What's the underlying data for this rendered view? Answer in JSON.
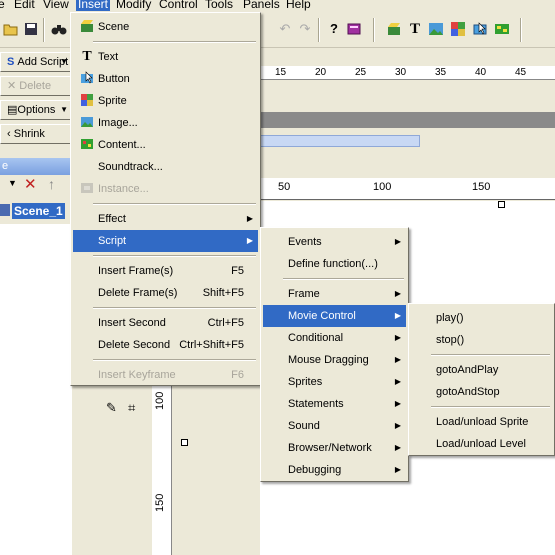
{
  "menubar": [
    "e",
    "Edit",
    "View",
    "Insert",
    "Modify",
    "Control",
    "Tools",
    "Panels",
    "Help"
  ],
  "left_panel": {
    "add_script": "Add Script",
    "delete": "Delete",
    "options": "Options",
    "shrink": "Shrink",
    "scene_header": "e",
    "scene_name": "Scene_1"
  },
  "ruler_top": [
    "15",
    "20",
    "25",
    "30",
    "35",
    "40",
    "45"
  ],
  "ruler_scene": [
    "50",
    "100",
    "150"
  ],
  "ruler_vertical": [
    "100",
    "150"
  ],
  "insert_menu": {
    "scene": "Scene",
    "text": "Text",
    "button": "Button",
    "sprite": "Sprite",
    "image": "Image...",
    "content": "Content...",
    "soundtrack": "Soundtrack...",
    "instance": "Instance...",
    "effect": "Effect",
    "script": "Script",
    "insert_frames": "Insert Frame(s)",
    "insert_frames_sc": "F5",
    "delete_frames": "Delete Frame(s)",
    "delete_frames_sc": "Shift+F5",
    "insert_second": "Insert Second",
    "insert_second_sc": "Ctrl+F5",
    "delete_second": "Delete Second",
    "delete_second_sc": "Ctrl+Shift+F5",
    "insert_keyframe": "Insert Keyframe",
    "insert_keyframe_sc": "F6"
  },
  "script_menu": {
    "events": "Events",
    "define_function": "Define function(...)",
    "frame": "Frame",
    "movie_control": "Movie Control",
    "conditional": "Conditional",
    "mouse_dragging": "Mouse Dragging",
    "sprites": "Sprites",
    "statements": "Statements",
    "sound": "Sound",
    "browser_network": "Browser/Network",
    "debugging": "Debugging"
  },
  "movie_control_menu": {
    "play": "play()",
    "stop": "stop()",
    "goto_and_play": "gotoAndPlay",
    "goto_and_stop": "gotoAndStop",
    "load_unload_sprite": "Load/unload Sprite",
    "load_unload_level": "Load/unload Level"
  },
  "colors": {
    "highlight": "#316ac5",
    "face": "#ece9d8"
  }
}
